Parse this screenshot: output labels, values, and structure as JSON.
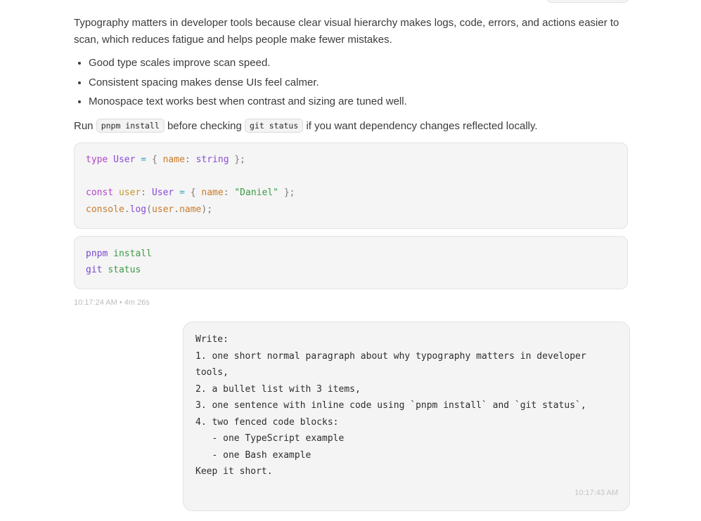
{
  "assistant": {
    "paragraph": "Typography matters in developer tools because clear visual hierarchy makes logs, code, errors, and actions easier to scan, which reduces fatigue and helps people make fewer mistakes.",
    "bullets": [
      "Good type scales improve scan speed.",
      "Consistent spacing makes dense UIs feel calmer.",
      "Monospace text works best when contrast and sizing are tuned well."
    ],
    "inline_sentence": {
      "prefix": "Run ",
      "code1": "pnpm install",
      "middle": " before checking ",
      "code2": "git status",
      "suffix": " if you want dependency changes reflected locally."
    },
    "ts_code": {
      "line1": {
        "kw": "type",
        "name": "User",
        "op": "=",
        "open": "{",
        "prop": "name",
        "colon": ":",
        "type": "string",
        "close": "};"
      },
      "line3": {
        "kw": "const",
        "var": "user",
        "colon": ":",
        "type": "User",
        "op": "=",
        "open": "{",
        "prop": "name",
        "colon2": ":",
        "str": "\"Daniel\"",
        "close": "};"
      },
      "line4": {
        "obj": "console",
        "dot": ".",
        "fn": "log",
        "open": "(",
        "var": "user",
        "dot2": ".",
        "prop": "name",
        "close": ");"
      }
    },
    "bash_code": {
      "line1": {
        "cmd": "pnpm",
        "arg": "install"
      },
      "line2": {
        "cmd": "git",
        "arg": "status"
      }
    },
    "meta": "10:17:24 AM • 4m 26s"
  },
  "user": {
    "message": "Write:\n1. one short normal paragraph about why typography matters in developer\ntools,\n2. a bullet list with 3 items,\n3. one sentence with inline code using `pnpm install` and `git status`,\n4. two fenced code blocks:\n   - one TypeScript example\n   - one Bash example\nKeep it short.",
    "timestamp": "10:17:43 AM"
  }
}
